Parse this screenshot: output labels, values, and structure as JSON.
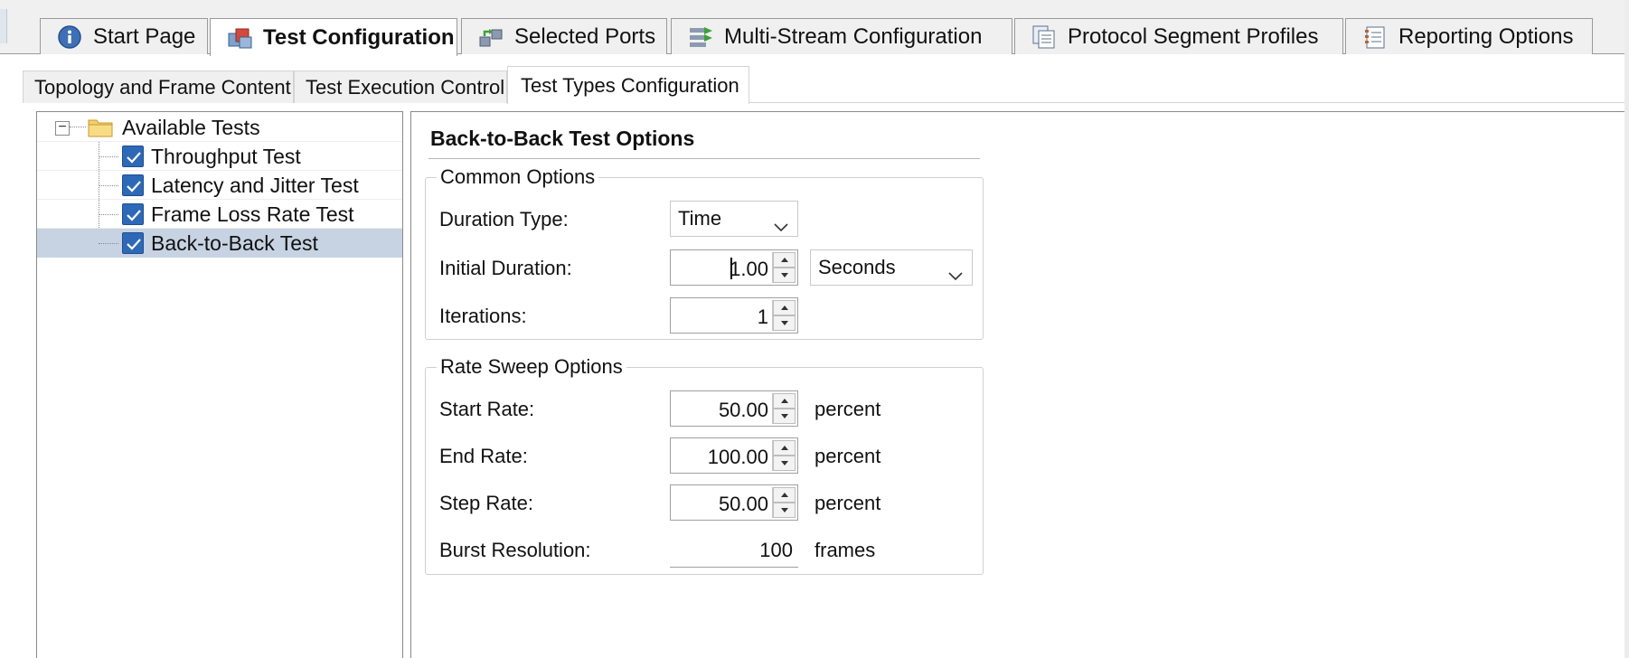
{
  "top_tabs": [
    {
      "label": "Start Page",
      "icon": "info-icon",
      "active": false
    },
    {
      "label": "Test Configuration",
      "icon": "test-config-icon",
      "active": true
    },
    {
      "label": "Selected Ports",
      "icon": "ports-icon",
      "active": false
    },
    {
      "label": "Multi-Stream Configuration",
      "icon": "multi-stream-icon",
      "active": false
    },
    {
      "label": "Protocol Segment Profiles",
      "icon": "protocol-profiles-icon",
      "active": false
    },
    {
      "label": "Reporting Options",
      "icon": "report-icon",
      "active": false
    }
  ],
  "sub_tabs": [
    {
      "label": "Topology and Frame Content",
      "active": false
    },
    {
      "label": "Test Execution Control",
      "active": false
    },
    {
      "label": "Test Types Configuration",
      "active": true
    }
  ],
  "tree": {
    "root": {
      "label": "Available Tests",
      "icon": "folder-icon",
      "expanded": true
    },
    "items": [
      {
        "label": "Throughput Test",
        "checked": true,
        "selected": false
      },
      {
        "label": "Latency and Jitter Test",
        "checked": true,
        "selected": false
      },
      {
        "label": "Frame Loss Rate Test",
        "checked": true,
        "selected": false
      },
      {
        "label": "Back-to-Back Test",
        "checked": true,
        "selected": true
      }
    ]
  },
  "options": {
    "title": "Back-to-Back Test Options",
    "common": {
      "legend": "Common Options",
      "duration_type_label": "Duration Type:",
      "duration_type_value": "Time",
      "initial_duration_label": "Initial Duration:",
      "initial_duration_value": "1.00",
      "initial_duration_unit": "Seconds",
      "iterations_label": "Iterations:",
      "iterations_value": "1"
    },
    "rate_sweep": {
      "legend": "Rate Sweep Options",
      "start_rate_label": "Start Rate:",
      "start_rate_value": "50.00",
      "start_rate_unit": "percent",
      "end_rate_label": "End Rate:",
      "end_rate_value": "100.00",
      "end_rate_unit": "percent",
      "step_rate_label": "Step Rate:",
      "step_rate_value": "50.00",
      "step_rate_unit": "percent",
      "burst_resolution_label": "Burst Resolution:",
      "burst_resolution_value": "100",
      "burst_resolution_unit": "frames"
    }
  },
  "colors": {
    "checkbox": "#2e69b8",
    "selection": "#c7d3e2",
    "tab_strip": "#f0f0f0"
  }
}
